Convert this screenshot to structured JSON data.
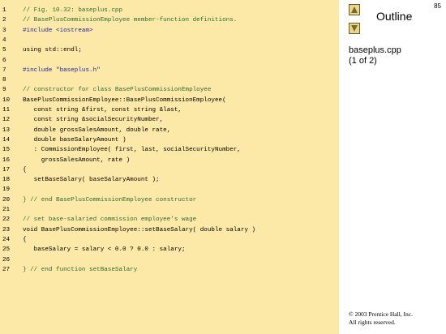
{
  "code": {
    "lines": [
      {
        "n": "1",
        "t": "// Fig. 10.32: baseplus.cpp",
        "c": "comment"
      },
      {
        "n": "2",
        "t": "// BasePlusCommissionEmployee member-function definitions.",
        "c": "comment"
      },
      {
        "n": "3",
        "t": "#include <iostream>",
        "c": "kw"
      },
      {
        "n": "4",
        "t": "",
        "c": ""
      },
      {
        "n": "5",
        "t": "using std::endl;",
        "c": ""
      },
      {
        "n": "6",
        "t": "",
        "c": ""
      },
      {
        "n": "7",
        "t": "#include \"baseplus.h\"",
        "c": "str"
      },
      {
        "n": "8",
        "t": "",
        "c": ""
      },
      {
        "n": "9",
        "t": "// constructor for class BasePlusCommissionEmployee",
        "c": "comment"
      },
      {
        "n": "10",
        "t": "BasePlusCommissionEmployee::BasePlusCommissionEmployee(",
        "c": ""
      },
      {
        "n": "11",
        "t": "   const string &first, const string &last,",
        "c": ""
      },
      {
        "n": "12",
        "t": "   const string &socialSecurityNumber,",
        "c": ""
      },
      {
        "n": "13",
        "t": "   double grossSalesAmount, double rate,",
        "c": ""
      },
      {
        "n": "14",
        "t": "   double baseSalaryAmount )",
        "c": ""
      },
      {
        "n": "15",
        "t": "   : CommissionEmployee( first, last, socialSecurityNumber,",
        "c": ""
      },
      {
        "n": "16",
        "t": "     grossSalesAmount, rate )",
        "c": ""
      },
      {
        "n": "17",
        "t": "{",
        "c": ""
      },
      {
        "n": "18",
        "t": "   setBaseSalary( baseSalaryAmount );",
        "c": ""
      },
      {
        "n": "19",
        "t": "",
        "c": ""
      },
      {
        "n": "20",
        "t": "} // end BasePlusCommissionEmployee constructor",
        "c": "comment"
      },
      {
        "n": "21",
        "t": "",
        "c": ""
      },
      {
        "n": "22",
        "t": "// set base-salaried commission employee's wage",
        "c": "comment"
      },
      {
        "n": "23",
        "t": "void BasePlusCommissionEmployee::setBaseSalary( double salary )",
        "c": ""
      },
      {
        "n": "24",
        "t": "{",
        "c": ""
      },
      {
        "n": "25",
        "t": "   baseSalary = salary < 0.0 ? 0.0 : salary;",
        "c": ""
      },
      {
        "n": "26",
        "t": "",
        "c": ""
      },
      {
        "n": "27",
        "t": "} // end function setBaseSalary",
        "c": "comment"
      }
    ]
  },
  "sidebar": {
    "title": "Outline",
    "page_number": "85",
    "file_name": "baseplus.cpp",
    "file_part": "(1 of 2)",
    "copyright_line1": "© 2003 Prentice Hall, Inc.",
    "copyright_line2": "All rights reserved."
  },
  "colors": {
    "panel_bg": "#fde9a7",
    "comment": "#2e6b2e",
    "keyword": "#1b1fa6"
  },
  "icons": {
    "up": "triangle-up-icon",
    "down": "triangle-down-icon"
  }
}
